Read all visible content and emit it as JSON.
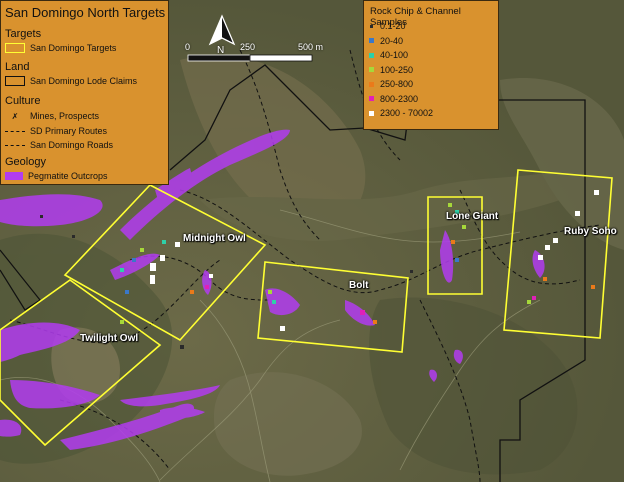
{
  "map": {
    "target_labels": [
      "Midnight Owl",
      "Twilight Owl",
      "Bolt",
      "Lone Giant",
      "Ruby Soho"
    ],
    "north_label": "N",
    "scale": {
      "tick_0": "0",
      "tick_1": "250",
      "tick_2": "500 m"
    }
  },
  "legend_left": {
    "title": "San Domingo North Targets",
    "targets_heading": "Targets",
    "targets_item": "San Domingo Targets",
    "land_heading": "Land",
    "land_item": "San Domingo Lode Claims",
    "culture_heading": "Culture",
    "culture_items": [
      "Mines, Prospects",
      "SD Primary Routes",
      "San Domingo Roads"
    ],
    "geology_heading": "Geology",
    "geology_item": "Pegmatite Outcrops"
  },
  "legend_right": {
    "title": "Rock Chip & Channel Samples",
    "classes": [
      {
        "label": "0.1-20",
        "color": "#2a2a2a"
      },
      {
        "label": "20-40",
        "color": "#3a78c8"
      },
      {
        "label": "40-100",
        "color": "#2fd0a8"
      },
      {
        "label": "100-250",
        "color": "#a6d83a"
      },
      {
        "label": "250-800",
        "color": "#ea7a1a"
      },
      {
        "label": "800-2300",
        "color": "#e020b8"
      },
      {
        "label": "2300 - 70002",
        "color": "#ffffff"
      }
    ]
  },
  "colors": {
    "target_outline": "#ffff33",
    "claims_outline": "#111111",
    "pegmatite": "#b23cf0",
    "legend_bg": "#d9922e"
  }
}
